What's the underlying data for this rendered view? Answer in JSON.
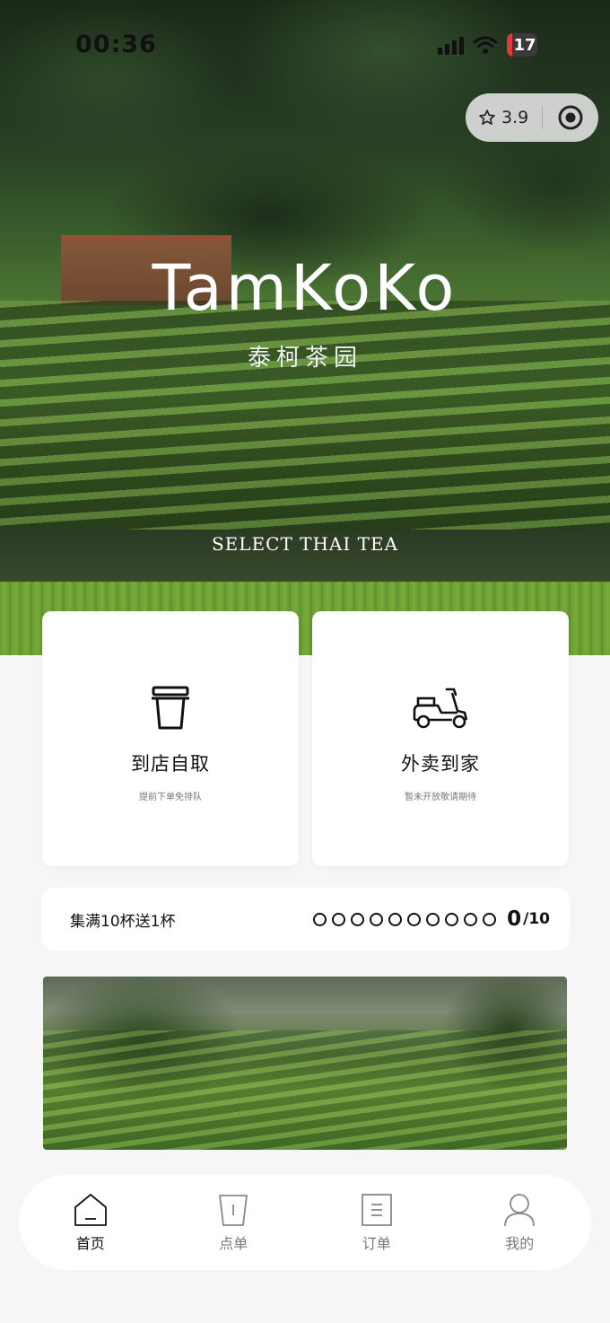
{
  "status_bar": {
    "time": "00:36",
    "battery_level": "17",
    "icons": [
      "signal-icon",
      "wifi-icon",
      "battery-icon"
    ]
  },
  "capsule": {
    "rating": "3.9",
    "icons": [
      "star-icon",
      "target-icon"
    ]
  },
  "hero": {
    "brand": "TamKoKo",
    "brand_cn": "泰柯茶园",
    "slogan": "SELECT THAI TEA"
  },
  "actions": [
    {
      "title": "到店自取",
      "subtitle": "提前下单免排队",
      "icon": "cup-icon"
    },
    {
      "title": "外卖到家",
      "subtitle": "暂未开放敬请期待",
      "icon": "scooter-icon"
    }
  ],
  "stamp_card": {
    "label": "集满10杯送1杯",
    "collected": "0",
    "total": "/10",
    "slots": 10
  },
  "colors": {
    "text": "#111111",
    "muted": "#7a7a7a",
    "card": "#ffffff",
    "background": "#f6f6f6",
    "battery_low": "#e23a3a"
  },
  "tabbar": {
    "tabs": [
      {
        "label": "首页",
        "icon": "home-icon",
        "active": true
      },
      {
        "label": "点单",
        "icon": "cup-icon",
        "active": false
      },
      {
        "label": "订单",
        "icon": "order-list-icon",
        "active": false
      },
      {
        "label": "我的",
        "icon": "user-icon",
        "active": false
      }
    ]
  }
}
